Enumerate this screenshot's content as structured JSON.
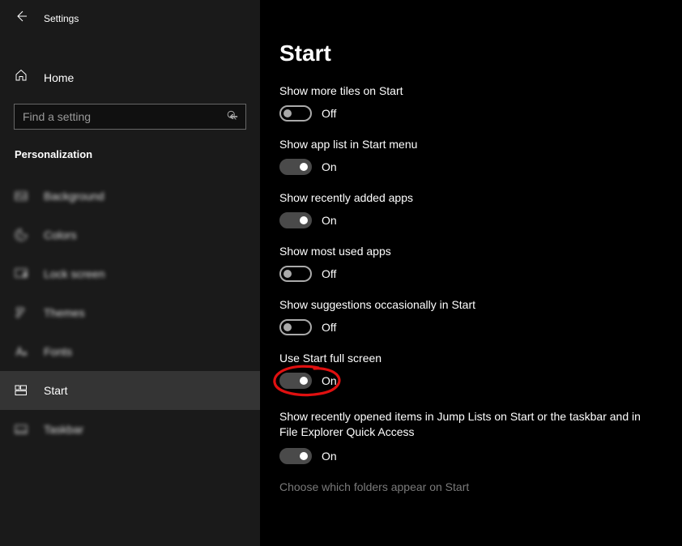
{
  "header": {
    "settings_label": "Settings"
  },
  "home_label": "Home",
  "search": {
    "placeholder": "Find a setting"
  },
  "category": "Personalization",
  "nav": {
    "background": "Background",
    "colors": "Colors",
    "lock_screen": "Lock screen",
    "themes": "Themes",
    "fonts": "Fonts",
    "start": "Start",
    "taskbar": "Taskbar"
  },
  "page": {
    "title": "Start",
    "settings": {
      "more_tiles": {
        "label": "Show more tiles on Start",
        "state": "Off",
        "on": false
      },
      "app_list": {
        "label": "Show app list in Start menu",
        "state": "On",
        "on": true
      },
      "recently_added": {
        "label": "Show recently added apps",
        "state": "On",
        "on": true
      },
      "most_used": {
        "label": "Show most used apps",
        "state": "Off",
        "on": false
      },
      "suggestions": {
        "label": "Show suggestions occasionally in Start",
        "state": "Off",
        "on": false
      },
      "full_screen": {
        "label": "Use Start full screen",
        "state": "On",
        "on": true
      },
      "jump_lists": {
        "label": "Show recently opened items in Jump Lists on Start or the taskbar and in File Explorer Quick Access",
        "state": "On",
        "on": true
      }
    },
    "link": "Choose which folders appear on Start"
  }
}
